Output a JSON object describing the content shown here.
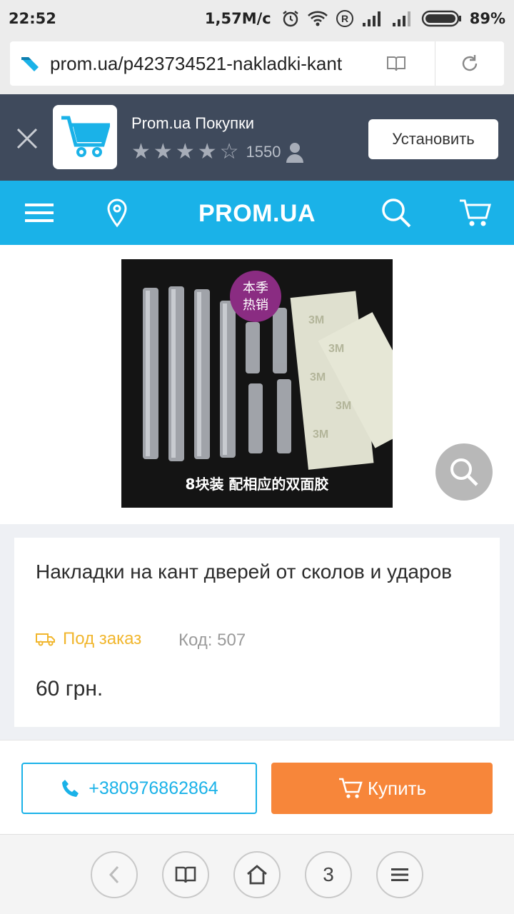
{
  "status_bar": {
    "time": "22:52",
    "speed": "1,57M/c",
    "battery": "89%",
    "icons": [
      "alarm-icon",
      "wifi-icon",
      "r-icon",
      "signal-icon",
      "signal-icon-2",
      "battery-icon"
    ]
  },
  "url_bar": {
    "url": "prom.ua/p423734521-nakladki-kant"
  },
  "app_banner": {
    "title": "Prom.ua Покупки",
    "rating_count": "1550",
    "install_label": "Установить",
    "stars": 4.5
  },
  "site_header": {
    "logo": "PROM.UA"
  },
  "product_image": {
    "badge_text_1": "本季",
    "badge_text_2": "热销",
    "caption": "8块装 配相应的双面胶",
    "tape_label": "3M"
  },
  "product": {
    "title": "Накладки на кант дверей от сколов и ударов",
    "availability": "Под заказ",
    "code": "Код: 507",
    "price": "60 грн."
  },
  "actions": {
    "phone": "+380976862864",
    "buy_label": "Купить"
  },
  "bottom_nav": {
    "tabs_count": "3"
  },
  "colors": {
    "brand_blue": "#1ab2e8",
    "buy_orange": "#f7863a",
    "availability_yellow": "#f1b62d",
    "banner_bg": "#3f4a5c"
  }
}
